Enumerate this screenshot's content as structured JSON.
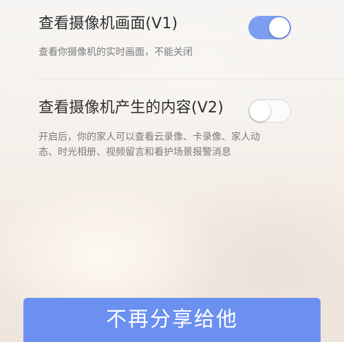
{
  "settings": {
    "view_camera": {
      "title": "查看摄像机画面(V1)",
      "description": "查看你摄像机的实时画面，不能关闭",
      "enabled": true
    },
    "view_content": {
      "title": "查看摄像机产生的内容(V2)",
      "description_line1": "开启后，你的家人可以查看云录像、卡录像、家人动",
      "description_line2": "态、时光相册、视频留言和看护场景报警消息",
      "enabled": false
    }
  },
  "actions": {
    "stop_sharing_label": "不再分享给他"
  },
  "colors": {
    "accent": "#6b90ef",
    "toggle_on": "#7b9ef0",
    "title_text": "#2f2f2f",
    "desc_text": "#7b7b7b"
  }
}
